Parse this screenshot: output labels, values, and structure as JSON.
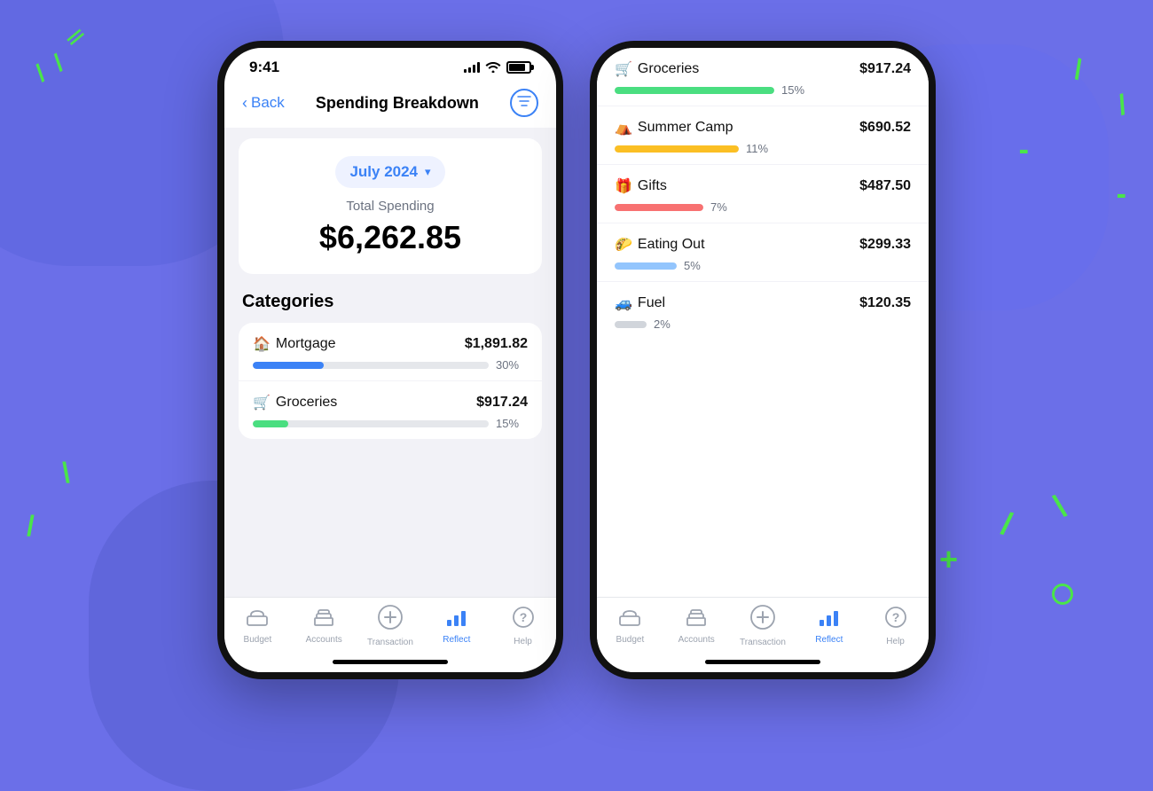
{
  "background": {
    "color": "#6B6FE8"
  },
  "phone1": {
    "status_bar": {
      "time": "9:41",
      "signal_level": 4,
      "wifi": true,
      "battery_percent": 80
    },
    "nav": {
      "back_label": "Back",
      "title": "Spending Breakdown",
      "filter_icon": "filter-icon"
    },
    "summary": {
      "month": "July 2024",
      "chevron": "▾",
      "total_label": "Total Spending",
      "total_amount": "$6,262.85"
    },
    "categories_title": "Categories",
    "categories": [
      {
        "emoji": "🏠",
        "name": "Mortgage",
        "amount": "$1,891.82",
        "percent": 30,
        "percent_label": "30%",
        "bar_color": "#3B82F6"
      },
      {
        "emoji": "🛒",
        "name": "Groceries",
        "amount": "$917.24",
        "percent": 15,
        "percent_label": "15%",
        "bar_color": "#4ADE80"
      }
    ],
    "tabs": [
      {
        "icon": "🏠",
        "label": "Budget",
        "active": false
      },
      {
        "icon": "🏛",
        "label": "Accounts",
        "active": false
      },
      {
        "icon": "➕",
        "label": "Transaction",
        "active": false
      },
      {
        "icon": "📊",
        "label": "Reflect",
        "active": true
      },
      {
        "icon": "❓",
        "label": "Help",
        "active": false
      }
    ]
  },
  "phone2": {
    "status_bar": {
      "time": "9:41",
      "signal_level": 4,
      "wifi": true,
      "battery_percent": 80
    },
    "categories": [
      {
        "emoji": "🛒",
        "name": "Groceries",
        "amount": "$917.24",
        "percent": 15,
        "percent_label": "15%",
        "bar_color": "#4ADE80"
      },
      {
        "emoji": "⛺",
        "name": "Summer Camp",
        "amount": "$690.52",
        "percent": 11,
        "percent_label": "11%",
        "bar_color": "#FBBF24"
      },
      {
        "emoji": "🎁",
        "name": "Gifts",
        "amount": "$487.50",
        "percent": 7,
        "percent_label": "7%",
        "bar_color": "#F87171"
      },
      {
        "emoji": "🌮",
        "name": "Eating Out",
        "amount": "$299.33",
        "percent": 5,
        "percent_label": "5%",
        "bar_color": "#93C5FD"
      },
      {
        "emoji": "🚙",
        "name": "Fuel",
        "amount": "$120.35",
        "percent": 2,
        "percent_label": "2%",
        "bar_color": "#D1D5DB"
      }
    ],
    "tabs": [
      {
        "icon": "🏠",
        "label": "Budget",
        "active": false
      },
      {
        "icon": "🏛",
        "label": "Accounts",
        "active": false
      },
      {
        "icon": "➕",
        "label": "Transaction",
        "active": false
      },
      {
        "icon": "📊",
        "label": "Reflect",
        "active": true
      },
      {
        "icon": "❓",
        "label": "Help",
        "active": false
      }
    ]
  }
}
